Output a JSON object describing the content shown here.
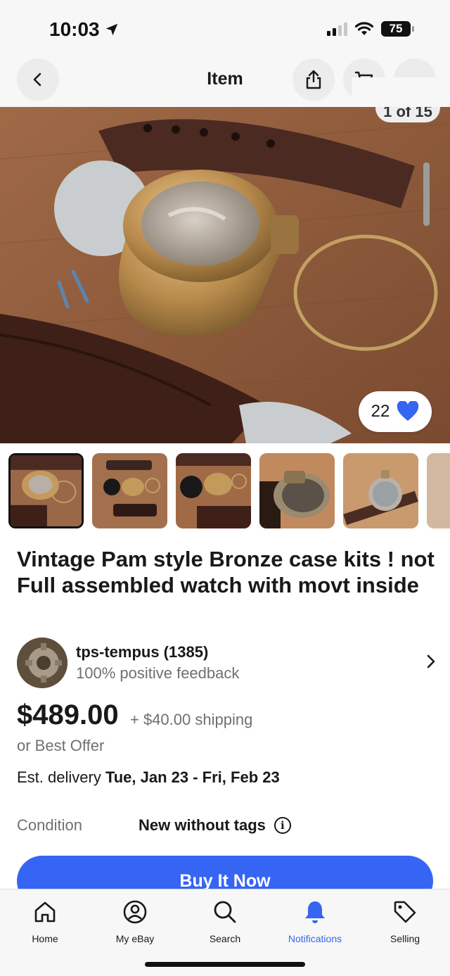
{
  "status_bar": {
    "time": "10:03",
    "battery": "75"
  },
  "nav": {
    "title": "Item"
  },
  "hero": {
    "image_counter": "1 of 15",
    "watch_count": "22"
  },
  "thumbnails": [
    "thumbnail-1",
    "thumbnail-2",
    "thumbnail-3",
    "thumbnail-4",
    "thumbnail-5"
  ],
  "listing": {
    "title": "Vintage Pam style  Bronze  case kits ! not Full assembled watch with movt inside",
    "seller": {
      "name": "tps-tempus (1385)",
      "feedback": "100% positive feedback"
    },
    "price": "$489.00",
    "shipping": "+ $40.00 shipping",
    "best_offer": "or Best Offer",
    "delivery_label": "Est. delivery ",
    "delivery_dates": "Tue, Jan 23 - Fri, Feb 23",
    "condition_label": "Condition",
    "condition_value": "New without tags",
    "buy_button": "Buy It Now"
  },
  "tabbar": {
    "items": [
      {
        "label": "Home",
        "icon": "home-icon"
      },
      {
        "label": "My eBay",
        "icon": "user-circle-icon"
      },
      {
        "label": "Search",
        "icon": "search-icon"
      },
      {
        "label": "Notifications",
        "icon": "bell-icon"
      },
      {
        "label": "Selling",
        "icon": "tag-icon"
      }
    ],
    "active": "Notifications"
  },
  "colors": {
    "accent": "#3665f3",
    "heart": "#3665f3",
    "text": "#191919",
    "muted": "#707070"
  }
}
